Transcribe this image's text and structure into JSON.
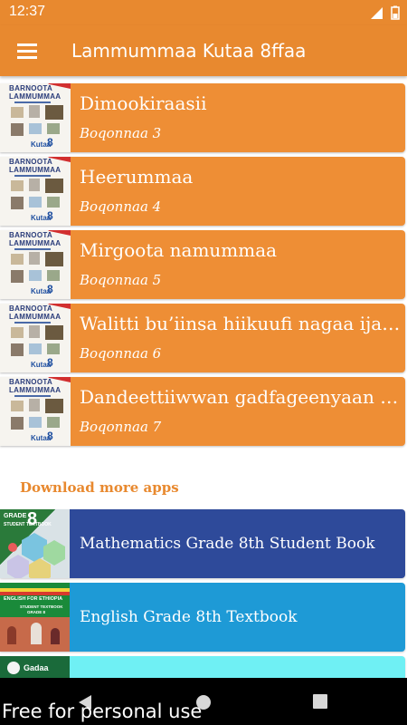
{
  "status_bar": {
    "time": "12:37"
  },
  "app_bar": {
    "title": "Lammummaa Kutaa 8ffaa"
  },
  "thumbnail": {
    "line1": "BARNOOTA",
    "line2": "LAMMUMMAA",
    "grade_word": "Kutaa",
    "grade_number": "8"
  },
  "chapters": [
    {
      "title": "Dimookiraasii",
      "subtitle": "Boqonnaa 3"
    },
    {
      "title": "Heerummaa",
      "subtitle": "Boqonnaa 4"
    },
    {
      "title": "Mirgoota namummaa",
      "subtitle": "Boqonnaa 5"
    },
    {
      "title": "Walitti bu’iinsa hiikuufi nagaa ijaaruu",
      "subtitle": "Boqonnaa 6"
    },
    {
      "title": "Dandeettiiwwan gadfageenyaan yaaduu",
      "subtitle": "Boqonnaa 7"
    }
  ],
  "download_section": {
    "label": "Download more apps",
    "apps": [
      {
        "name": "Mathematics Grade 8th Student Book",
        "thumb_top": "GRADE",
        "thumb_mid": "STUDENT TEXTBOOK",
        "thumb_num": "8",
        "bg": "#2e4a9a"
      },
      {
        "name": "English Grade 8th Textbook",
        "thumb_top": "ENGLISH FOR ETHIOPIA",
        "thumb_mid": "STUDENT TEXTBOOK",
        "thumb_num": "GRADE 8",
        "bg": "#1e9ad6"
      },
      {
        "name": "",
        "thumb_top": "Gadaa",
        "bg": "#6ff0f4"
      }
    ]
  },
  "watermark": "Free for personal use",
  "colors": {
    "primary": "#e8892f",
    "card": "#ee8e35",
    "nav_bar": "#000000"
  }
}
